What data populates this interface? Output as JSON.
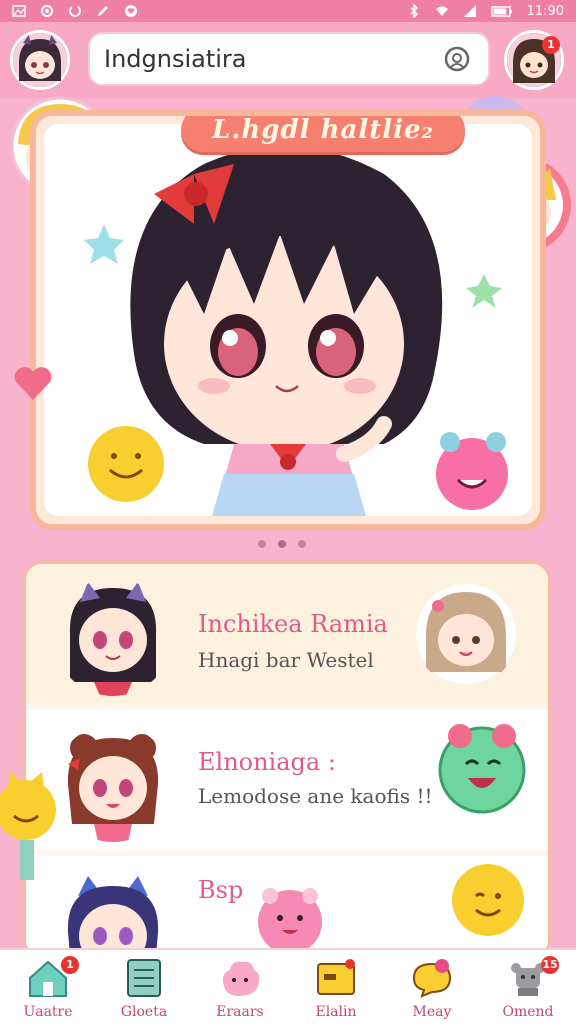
{
  "status_bar": {
    "time": "11:90",
    "battery_level": 0.85
  },
  "header": {
    "search_value": "Indgnsiatira",
    "right_avatar_badge": "1"
  },
  "hero": {
    "title": "L.hgdl haltlie₂",
    "carousel_pages": 3,
    "carousel_active": 1
  },
  "list": [
    {
      "title": "Inchikea Ramia",
      "subtitle": "Hnagi bar Westel"
    },
    {
      "title": "Elnoniaga :",
      "subtitle": "Lemodose ane kaofis !!"
    },
    {
      "title": "Bsp",
      "subtitle": ""
    }
  ],
  "bottom_nav": [
    {
      "label": "Uaatre",
      "icon": "home-icon",
      "badge": "1"
    },
    {
      "label": "Gloeta",
      "icon": "list-icon",
      "badge": ""
    },
    {
      "label": "Eraars",
      "icon": "cloud-creature-icon",
      "badge": ""
    },
    {
      "label": "Elalin",
      "icon": "folder-icon",
      "badge": ""
    },
    {
      "label": "Meay",
      "icon": "chat-icon",
      "badge": ""
    },
    {
      "label": "Omend",
      "icon": "robot-icon",
      "badge": "15"
    }
  ],
  "colors": {
    "accent": "#f07fa6",
    "title_pill": "#f6806f",
    "list_title": "#e05a8a",
    "badge": "#e8342f"
  }
}
